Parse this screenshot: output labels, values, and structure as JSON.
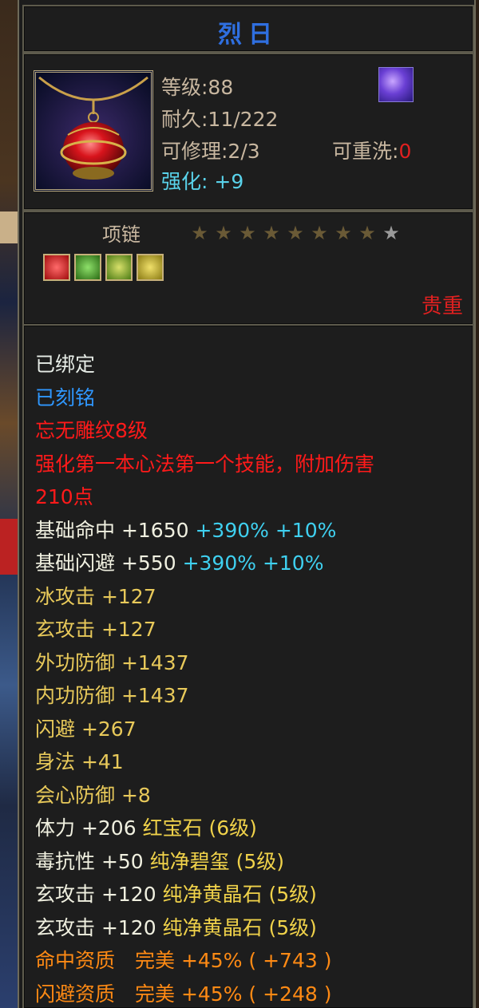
{
  "item": {
    "name": "烈日",
    "level": "等级:88",
    "durability": "耐久:11/222",
    "repair_label": "可修理:2/3",
    "rewash_label": "可重洗:",
    "rewash_value": "0",
    "enhance_label": "强化:",
    "enhance_value": "+9",
    "type": "项链",
    "stars_filled": 8,
    "stars_total": 9,
    "rarity": "贵重",
    "gem_colors": [
      "#d81c1c",
      "#3d9e2a",
      "#6aa52a",
      "#c9b530"
    ],
    "accent_colors": {
      "title": "#2f6fe0",
      "cyan": "#59d2ea",
      "red": "#e02020",
      "yellow": "#e8c95a",
      "orange": "#ff8a14"
    }
  },
  "attributes": [
    {
      "text": "已绑定",
      "color": "white"
    },
    {
      "text": "已刻铭",
      "color": "blue"
    },
    {
      "text": "忘无雕纹8级",
      "color": "red"
    },
    {
      "text": "强化第一本心法第一个技能，附加伤害",
      "color": "red"
    },
    {
      "text": "210点",
      "color": "red"
    },
    {
      "text": "基础命中 +1650",
      "extra": " +390% +10%",
      "color": "light",
      "extra_color": "cyan"
    },
    {
      "text": "基础闪避 +550",
      "extra": " +390% +10%",
      "color": "light",
      "extra_color": "cyan"
    },
    {
      "text": "冰攻击 +127",
      "color": "yellow"
    },
    {
      "text": "玄攻击 +127",
      "color": "yellow"
    },
    {
      "text": "外功防御 +1437",
      "color": "yellow"
    },
    {
      "text": "内功防御 +1437",
      "color": "yellow"
    },
    {
      "text": "闪避 +267",
      "color": "yellow"
    },
    {
      "text": "身法 +41",
      "color": "yellow"
    },
    {
      "text": "会心防御 +8",
      "color": "yellow"
    },
    {
      "text": "体力 +206",
      "extra": " 红宝石 (6级)",
      "color": "light",
      "extra_color": "yellow"
    },
    {
      "text": "毒抗性 +50",
      "extra": " 纯净碧玺 (5级)",
      "color": "light",
      "extra_color": "yellow"
    },
    {
      "text": "玄攻击 +120",
      "extra": " 纯净黄晶石 (5级)",
      "color": "light",
      "extra_color": "yellow"
    },
    {
      "text": "玄攻击 +120",
      "extra": " 纯净黄晶石 (5级)",
      "color": "light",
      "extra_color": "yellow"
    },
    {
      "text": "命中资质　完美 +45% ( +743 )",
      "color": "orange"
    },
    {
      "text": "闪避资质　完美 +45% ( +248 )",
      "color": "orange"
    }
  ]
}
